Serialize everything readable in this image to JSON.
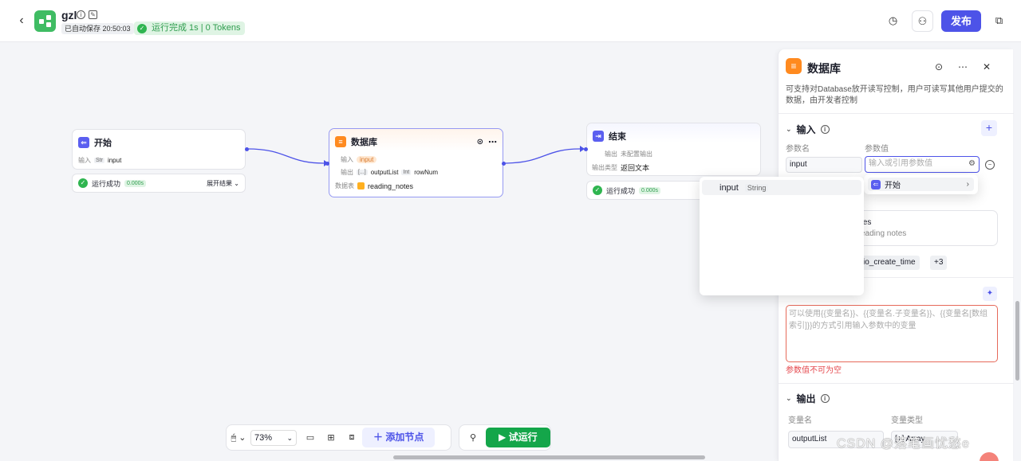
{
  "header": {
    "app_name": "gzl",
    "autosave": "已自动保存 20:50:03",
    "run_status": "运行完成 1s | 0 Tokens",
    "publish_label": "发布"
  },
  "nodes": {
    "start": {
      "title": "开始",
      "input_label": "输入",
      "input_type": "Str",
      "input_name": "input",
      "status": "运行成功",
      "time": "0.000s",
      "expand": "展开结果"
    },
    "database": {
      "title": "数据库",
      "input_label": "输入",
      "input_name": "input",
      "output_label": "输出",
      "output_list_type": "[...]",
      "output_list": "outputList",
      "output_num_type": "Int",
      "output_num": "rowNum",
      "table_label": "数据表",
      "table_name": "reading_notes"
    },
    "end": {
      "title": "结束",
      "output_label": "输出",
      "output_value": "未配置输出",
      "output_type_label": "输出类型",
      "output_type_value": "返回文本",
      "status": "运行成功",
      "time": "0.000s"
    }
  },
  "toolbar": {
    "zoom": "73%",
    "add_node": "添加节点",
    "trial_run": "试运行"
  },
  "panel": {
    "title": "数据库",
    "description": "可支持对Database放开读写控制，用户可读写其他用户提交的数据，由开发者控制",
    "input_section": "输入",
    "param_name_label": "参数名",
    "param_value_label": "参数值",
    "param_name": "input",
    "param_value_placeholder": "输入或引用参数值",
    "table_partial_title": "tes",
    "table_partial_desc": "eading notes",
    "field_partial": "io_create_time",
    "field_more": "+3",
    "sql_placeholder": "可以使用{{变量名}}、{{变量名.子变量名}}、{{变量名[数组索引]}}的方式引用输入参数中的变量",
    "sql_error": "参数值不可为空",
    "output_section": "输出",
    "var_name_label": "变量名",
    "var_type_label": "变量类型",
    "output_var": "outputList",
    "output_type_partial": "[+] Array"
  },
  "dropdown": {
    "node_option": "开始"
  },
  "popup": {
    "item_name": "input",
    "item_type": "String"
  },
  "watermark": "CSDN @落笔画忧愁e"
}
